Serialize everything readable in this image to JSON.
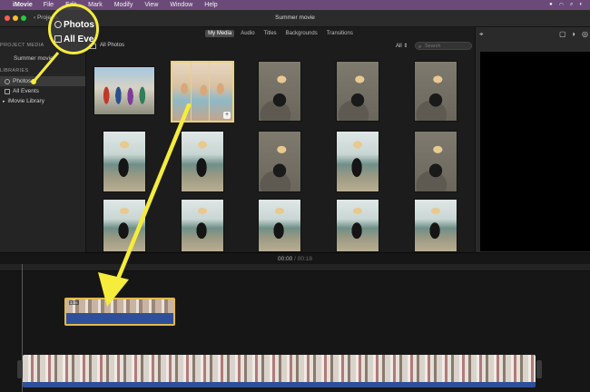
{
  "menubar": {
    "app_name": "iMovie",
    "items": [
      "File",
      "Edit",
      "Mark",
      "Modify",
      "View",
      "Window",
      "Help"
    ]
  },
  "titlebar": {
    "back_label": "‹ Projects",
    "title": "Summer movie"
  },
  "sidebar": {
    "project_media_header": "PROJECT MEDIA",
    "project_item": "Summer movie",
    "libraries_header": "LIBRARIES",
    "libraries": [
      {
        "label": "Photos",
        "selected": true
      },
      {
        "label": "All Events",
        "selected": false
      },
      {
        "label": "iMovie Library",
        "selected": false
      }
    ]
  },
  "callout": {
    "photos_label": "Photos",
    "all_events_label": "All Eve"
  },
  "browser": {
    "tabs": [
      "My Media",
      "Audio",
      "Titles",
      "Backgrounds",
      "Transitions"
    ],
    "active_tab": "My Media",
    "source_label": "All Photos",
    "filter_label": "All",
    "search_placeholder": "Search"
  },
  "timeline": {
    "current_time": "00:00",
    "separator": "/",
    "total_time": "00:18",
    "cut_clip_label": "1.0s"
  },
  "colors": {
    "menubar": "#6b4a7a",
    "annotation": "#f5ec3b",
    "clip_selection": "#e3b94a",
    "clip_body": "#2e4f9a"
  }
}
